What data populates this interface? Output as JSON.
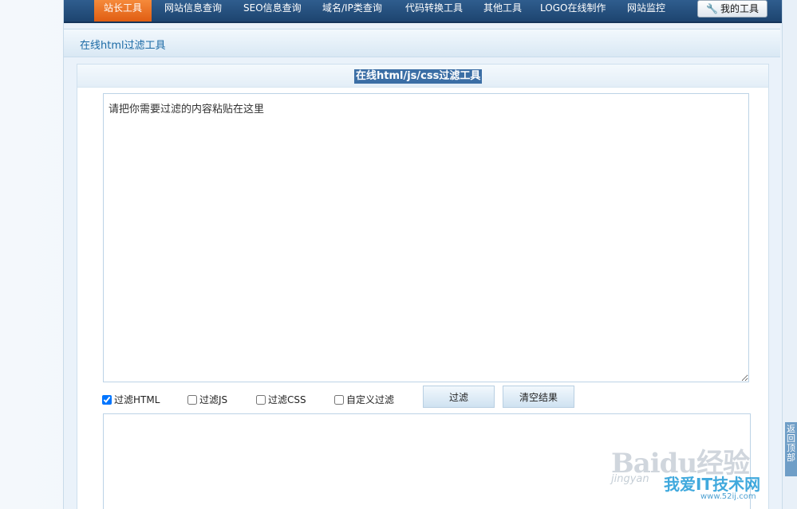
{
  "nav": {
    "items": [
      {
        "label": "站长工具",
        "active": true
      },
      {
        "label": "网站信息查询"
      },
      {
        "label": "SEO信息查询"
      },
      {
        "label": "域名/IP类查询"
      },
      {
        "label": "代码转换工具"
      },
      {
        "label": "其他工具"
      },
      {
        "label": "LOGO在线制作"
      },
      {
        "label": "网站监控"
      }
    ],
    "my_tools_label": "我的工具",
    "my_tools_icon": "wrench-icon"
  },
  "subheader": {
    "title": "在线html过滤工具"
  },
  "panel": {
    "title": "在线html/js/css过滤工具",
    "input_value": "请把你需要过滤的内容粘贴在这里",
    "output_value": ""
  },
  "options": [
    {
      "label": "过滤HTML",
      "checked": true
    },
    {
      "label": "过滤JS",
      "checked": false
    },
    {
      "label": "过滤CSS",
      "checked": false
    },
    {
      "label": "自定义过滤",
      "checked": false
    }
  ],
  "buttons": {
    "filter": "过滤",
    "clear": "清空结果"
  },
  "side": {
    "back_label": "返回顶部"
  },
  "watermark": {
    "brand": "Baidu经验",
    "sub": "jingyan",
    "site": "我爱IT技术网",
    "url": "www.52ij.com"
  }
}
